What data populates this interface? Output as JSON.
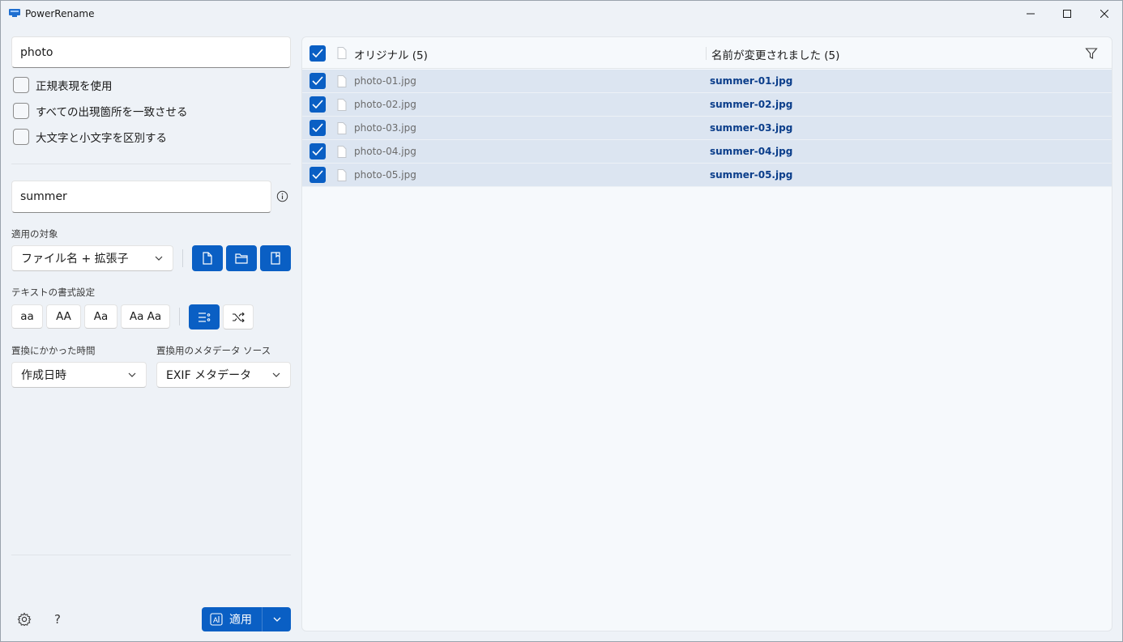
{
  "window": {
    "title": "PowerRename"
  },
  "search": {
    "value": "photo"
  },
  "options": {
    "use_regex": "正規表現を使用",
    "match_all": "すべての出現箇所を一致させる",
    "case_sensitive": "大文字と小文字を区別する"
  },
  "replace": {
    "value": "summer"
  },
  "apply_to": {
    "label": "適用の対象",
    "selected": "ファイル名 + 拡張子"
  },
  "text_format": {
    "label": "テキストの書式設定",
    "lower": "aa",
    "upper": "AA",
    "title": "Aa",
    "capitalize": "Aa Aa"
  },
  "time": {
    "label": "置換にかかった時間",
    "selected": "作成日時"
  },
  "metadata": {
    "label": "置換用のメタデータ ソース",
    "selected": "EXIF メタデータ"
  },
  "footer": {
    "help": "?",
    "apply_label": "適用"
  },
  "list": {
    "original_header": "オリジナル (5)",
    "renamed_header": "名前が変更されました (5)",
    "rows": [
      {
        "original": "photo-01.jpg",
        "renamed": "summer-01.jpg"
      },
      {
        "original": "photo-02.jpg",
        "renamed": "summer-02.jpg"
      },
      {
        "original": "photo-03.jpg",
        "renamed": "summer-03.jpg"
      },
      {
        "original": "photo-04.jpg",
        "renamed": "summer-04.jpg"
      },
      {
        "original": "photo-05.jpg",
        "renamed": "summer-05.jpg"
      }
    ]
  },
  "colors": {
    "accent": "#0a5fc4",
    "row_selected": "#dce5f1",
    "renamed_text": "#0a3d8a"
  }
}
